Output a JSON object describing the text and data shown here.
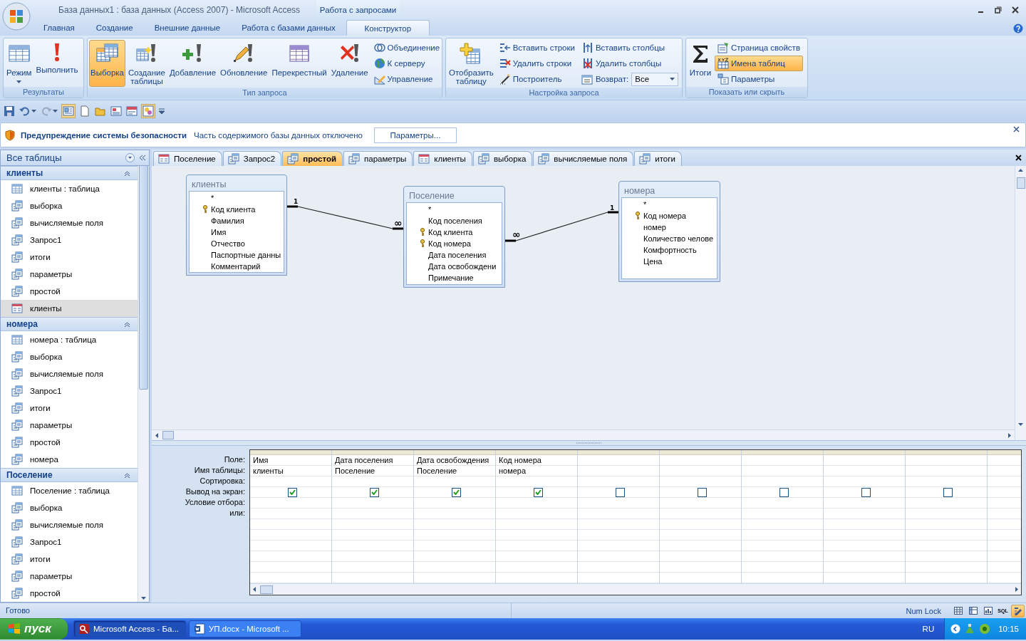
{
  "window": {
    "title": "База данных1 : база данных (Access 2007) - Microsoft Access",
    "contextual_group": "Работа с запросами"
  },
  "ribbon_tabs": [
    {
      "label": "Главная",
      "selected": false
    },
    {
      "label": "Создание",
      "selected": false
    },
    {
      "label": "Внешние данные",
      "selected": false
    },
    {
      "label": "Работа с базами данных",
      "selected": false
    },
    {
      "label": "Конструктор",
      "selected": true
    }
  ],
  "ribbon_groups": [
    {
      "label": "Результаты",
      "items": [
        {
          "kind": "large",
          "label": "Режим",
          "dropdown": true,
          "selected": false
        },
        {
          "kind": "large",
          "label": "Выполнить",
          "dropdown": false,
          "selected": false
        }
      ]
    },
    {
      "label": "Тип запроса",
      "items": [
        {
          "kind": "large",
          "label": "Выборка",
          "dropdown": false,
          "selected": true
        },
        {
          "kind": "large",
          "label": "Создание таблицы",
          "dropdown": false,
          "selected": false
        },
        {
          "kind": "large",
          "label": "Добавление",
          "dropdown": false,
          "selected": false
        },
        {
          "kind": "large",
          "label": "Обновление",
          "dropdown": false,
          "selected": false
        },
        {
          "kind": "large",
          "label": "Перекрестный",
          "dropdown": false,
          "selected": false
        },
        {
          "kind": "large",
          "label": "Удаление",
          "dropdown": false,
          "selected": false
        },
        {
          "kind": "small",
          "label": "Объединение",
          "selected": false
        },
        {
          "kind": "small",
          "label": "К серверу",
          "selected": false
        },
        {
          "kind": "small",
          "label": "Управление",
          "selected": false
        }
      ]
    },
    {
      "label": "Настройка запроса",
      "items": [
        {
          "kind": "large",
          "label": "Отобразить таблицу",
          "dropdown": false,
          "selected": false
        },
        {
          "kind": "small",
          "label": "Вставить строки",
          "selected": false
        },
        {
          "kind": "small",
          "label": "Удалить строки",
          "selected": false
        },
        {
          "kind": "small",
          "label": "Построитель",
          "selected": false
        },
        {
          "kind": "small",
          "label": "Вставить столбцы",
          "selected": false
        },
        {
          "kind": "small",
          "label": "Удалить столбцы",
          "selected": false
        },
        {
          "kind": "combo",
          "label": "Возврат:",
          "value": "Все"
        }
      ]
    },
    {
      "label": "Показать или скрыть",
      "items": [
        {
          "kind": "large",
          "label": "Итоги",
          "dropdown": false,
          "selected": false
        },
        {
          "kind": "small",
          "label": "Страница свойств",
          "selected": false
        },
        {
          "kind": "small",
          "label": "Имена таблиц",
          "selected": true
        },
        {
          "kind": "small",
          "label": "Параметры",
          "selected": false
        }
      ]
    }
  ],
  "security_warning": {
    "title": "Предупреждение системы безопасности",
    "message": "Часть содержимого базы данных отключено",
    "button": "Параметры..."
  },
  "nav": {
    "title": "Все таблицы",
    "groups": [
      {
        "title": "клиенты",
        "expanded": true,
        "items": [
          {
            "label": "клиенты : таблица",
            "kind": "table",
            "selected": false
          },
          {
            "label": "выборка",
            "kind": "query",
            "selected": false
          },
          {
            "label": "вычисляемые поля",
            "kind": "query",
            "selected": false
          },
          {
            "label": "Запрос1",
            "kind": "query",
            "selected": false
          },
          {
            "label": "итоги",
            "kind": "query",
            "selected": false
          },
          {
            "label": "параметры",
            "kind": "query",
            "selected": false
          },
          {
            "label": "простой",
            "kind": "query",
            "selected": false
          },
          {
            "label": "клиенты",
            "kind": "form",
            "selected": true
          }
        ]
      },
      {
        "title": "номера",
        "expanded": true,
        "items": [
          {
            "label": "номера : таблица",
            "kind": "table",
            "selected": false
          },
          {
            "label": "выборка",
            "kind": "query",
            "selected": false
          },
          {
            "label": "вычисляемые поля",
            "kind": "query",
            "selected": false
          },
          {
            "label": "Запрос1",
            "kind": "query",
            "selected": false
          },
          {
            "label": "итоги",
            "kind": "query",
            "selected": false
          },
          {
            "label": "параметры",
            "kind": "query",
            "selected": false
          },
          {
            "label": "простой",
            "kind": "query",
            "selected": false
          },
          {
            "label": "номера",
            "kind": "query",
            "selected": false
          }
        ]
      },
      {
        "title": "Поселение",
        "expanded": true,
        "items": [
          {
            "label": "Поселение : таблица",
            "kind": "table",
            "selected": false
          },
          {
            "label": "выборка",
            "kind": "query",
            "selected": false
          },
          {
            "label": "вычисляемые поля",
            "kind": "query",
            "selected": false
          },
          {
            "label": "Запрос1",
            "kind": "query",
            "selected": false
          },
          {
            "label": "итоги",
            "kind": "query",
            "selected": false
          },
          {
            "label": "параметры",
            "kind": "query",
            "selected": false
          },
          {
            "label": "простой",
            "kind": "query",
            "selected": false
          }
        ]
      }
    ]
  },
  "document_tabs": [
    {
      "label": "Поселение",
      "kind": "form",
      "selected": false
    },
    {
      "label": "Запрос2",
      "kind": "query",
      "selected": false
    },
    {
      "label": "простой",
      "kind": "query",
      "selected": true
    },
    {
      "label": "параметры",
      "kind": "query",
      "selected": false
    },
    {
      "label": "клиенты",
      "kind": "form",
      "selected": false
    },
    {
      "label": "выборка",
      "kind": "query",
      "selected": false
    },
    {
      "label": "вычисляемые поля",
      "kind": "query",
      "selected": false
    },
    {
      "label": "итоги",
      "kind": "query",
      "selected": false
    }
  ],
  "diagram": {
    "tables": [
      {
        "title": "клиенты",
        "fields": [
          {
            "name": "*",
            "key": false
          },
          {
            "name": "Код клиента",
            "key": true
          },
          {
            "name": "Фамилия",
            "key": false
          },
          {
            "name": "Имя",
            "key": false
          },
          {
            "name": "Отчество",
            "key": false
          },
          {
            "name": "Паспортные данны",
            "key": false
          },
          {
            "name": "Комментарий",
            "key": false
          }
        ]
      },
      {
        "title": "Поселение",
        "fields": [
          {
            "name": "*",
            "key": false
          },
          {
            "name": "Код поселения",
            "key": false
          },
          {
            "name": "Код клиента",
            "key": true
          },
          {
            "name": "Код номера",
            "key": true
          },
          {
            "name": "Дата поселения",
            "key": false
          },
          {
            "name": "Дата освобождени",
            "key": false
          },
          {
            "name": "Примечание",
            "key": false
          }
        ]
      },
      {
        "title": "номера",
        "fields": [
          {
            "name": "*",
            "key": false
          },
          {
            "name": "Код номера",
            "key": true
          },
          {
            "name": "номер",
            "key": false
          },
          {
            "name": "Количество челове",
            "key": false
          },
          {
            "name": "Комфортность",
            "key": false
          },
          {
            "name": "Цена",
            "key": false
          }
        ]
      }
    ],
    "relations": [
      {
        "one": "1",
        "many": "∞"
      },
      {
        "one": "1",
        "many": "∞"
      }
    ]
  },
  "query_grid": {
    "row_labels": [
      "Поле:",
      "Имя таблицы:",
      "Сортировка:",
      "Вывод на экран:",
      "Условие отбора:",
      "или:"
    ],
    "columns": [
      {
        "field": "Имя",
        "table": "клиенты",
        "show": true
      },
      {
        "field": "Дата поселения",
        "table": "Поселение",
        "show": true
      },
      {
        "field": "Дата освобождения",
        "table": "Поселение",
        "show": true
      },
      {
        "field": "Код номера",
        "table": "номера",
        "show": true
      },
      {
        "show": false
      },
      {
        "show": false
      },
      {
        "show": false
      },
      {
        "show": false
      },
      {
        "show": false
      }
    ]
  },
  "status_bar": {
    "text": "Готово",
    "indicator": "Num Lock",
    "views": [
      {
        "kind": "datasheet",
        "selected": false
      },
      {
        "kind": "pivottable",
        "selected": false
      },
      {
        "kind": "pivotchart",
        "selected": false
      },
      {
        "kind": "sql",
        "label": "SQL",
        "selected": false
      },
      {
        "kind": "design",
        "selected": true
      }
    ]
  },
  "taskbar": {
    "start": "пуск",
    "tasks": [
      {
        "label": "Microsoft Access - Ба...",
        "kind": "access",
        "selected": true
      },
      {
        "label": "УП.docx - Microsoft ...",
        "kind": "word",
        "selected": false
      }
    ],
    "language": "RU",
    "clock": "10:15"
  }
}
